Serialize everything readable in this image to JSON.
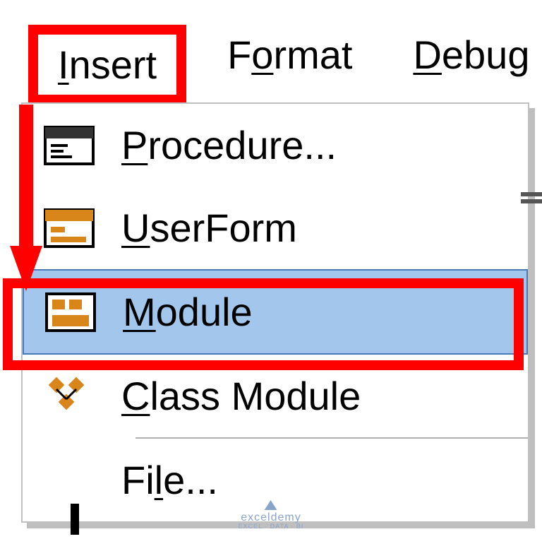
{
  "menubar": {
    "insert": "Insert",
    "format": "Format",
    "debug": "Debug"
  },
  "dropdown": {
    "procedure": "Procedure...",
    "userform": "UserForm",
    "module": "Module",
    "class_module": "Class Module",
    "file": "File..."
  },
  "watermark": {
    "brand": "exceldemy",
    "tagline": "EXCEL · DATA · BI"
  },
  "icons": {
    "procedure": "procedure-icon",
    "userform": "userform-icon",
    "module": "module-icon",
    "class_module": "class-module-icon"
  },
  "colors": {
    "highlight": "#ff0000",
    "selection": "#a3c6ed",
    "icon_orange": "#d8861a"
  }
}
